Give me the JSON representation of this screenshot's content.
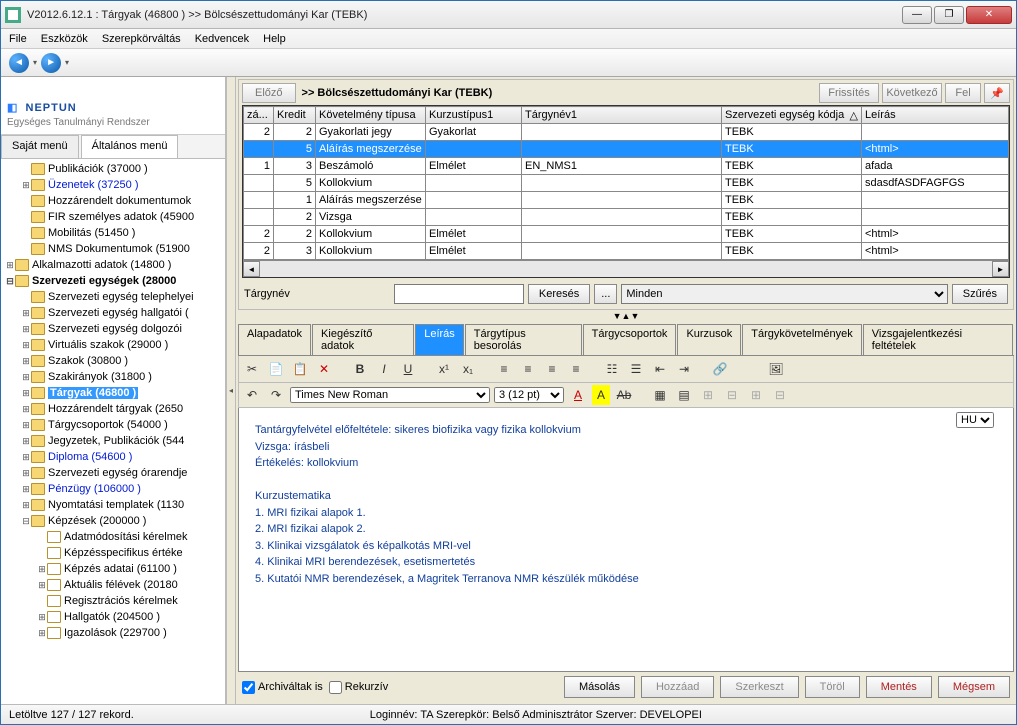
{
  "title": "V2012.6.12.1 : Tárgyak (46800  )  >> Bölcsészettudományi Kar (TEBK)",
  "menu": [
    "File",
    "Eszközök",
    "Szerepkörváltás",
    "Kedvencek",
    "Help"
  ],
  "logo": {
    "l1": "NEPTUN",
    "l2": "Egységes Tanulmányi Rendszer"
  },
  "left_tabs": {
    "t1": "Saját menü",
    "t2": "Általános menü"
  },
  "tree": [
    {
      "ind": 1,
      "tw": "",
      "ic": "f",
      "cls": "",
      "label": "Publikációk (37000  )"
    },
    {
      "ind": 1,
      "tw": "⊞",
      "ic": "f",
      "cls": "blue",
      "label": "Üzenetek (37250  )"
    },
    {
      "ind": 1,
      "tw": "",
      "ic": "f",
      "cls": "",
      "label": "Hozzárendelt dokumentumok"
    },
    {
      "ind": 1,
      "tw": "",
      "ic": "f",
      "cls": "",
      "label": "FIR személyes adatok (45900"
    },
    {
      "ind": 1,
      "tw": "",
      "ic": "f",
      "cls": "",
      "label": "Mobilitás (51450  )"
    },
    {
      "ind": 1,
      "tw": "",
      "ic": "f",
      "cls": "",
      "label": "NMS Dokumentumok (51900"
    },
    {
      "ind": 0,
      "tw": "⊞",
      "ic": "d",
      "cls": "",
      "label": "Alkalmazotti adatok (14800  )"
    },
    {
      "ind": 0,
      "tw": "⊟",
      "ic": "d",
      "cls": "bold",
      "label": "Szervezeti egységek (28000"
    },
    {
      "ind": 1,
      "tw": "",
      "ic": "f",
      "cls": "",
      "label": "Szervezeti egység telephelyei"
    },
    {
      "ind": 1,
      "tw": "⊞",
      "ic": "f",
      "cls": "",
      "label": "Szervezeti egység hallgatói ("
    },
    {
      "ind": 1,
      "tw": "⊞",
      "ic": "f",
      "cls": "",
      "label": "Szervezeti egység dolgozói"
    },
    {
      "ind": 1,
      "tw": "⊞",
      "ic": "f",
      "cls": "",
      "label": "Virtuális szakok (29000  )"
    },
    {
      "ind": 1,
      "tw": "⊞",
      "ic": "f",
      "cls": "",
      "label": "Szakok (30800  )"
    },
    {
      "ind": 1,
      "tw": "⊞",
      "ic": "f",
      "cls": "",
      "label": "Szakirányok (31800  )"
    },
    {
      "ind": 1,
      "tw": "⊞",
      "ic": "f",
      "cls": "sel",
      "label": "Tárgyak (46800  )"
    },
    {
      "ind": 1,
      "tw": "⊞",
      "ic": "f",
      "cls": "",
      "label": "Hozzárendelt tárgyak (2650"
    },
    {
      "ind": 1,
      "tw": "⊞",
      "ic": "f",
      "cls": "",
      "label": "Tárgycsoportok (54000  )"
    },
    {
      "ind": 1,
      "tw": "⊞",
      "ic": "f",
      "cls": "",
      "label": "Jegyzetek, Publikációk (544"
    },
    {
      "ind": 1,
      "tw": "⊞",
      "ic": "f",
      "cls": "blue",
      "label": "Diploma (54600  )"
    },
    {
      "ind": 1,
      "tw": "⊞",
      "ic": "f",
      "cls": "",
      "label": "Szervezeti egység órarendje"
    },
    {
      "ind": 1,
      "tw": "⊞",
      "ic": "f",
      "cls": "blue",
      "label": "Pénzügy (106000  )"
    },
    {
      "ind": 1,
      "tw": "⊞",
      "ic": "f",
      "cls": "",
      "label": "Nyomtatási templatek (1130"
    },
    {
      "ind": 1,
      "tw": "⊟",
      "ic": "f",
      "cls": "",
      "label": "Képzések (200000  )"
    },
    {
      "ind": 2,
      "tw": "",
      "ic": "p",
      "cls": "",
      "label": "Adatmódosítási kérelmek"
    },
    {
      "ind": 2,
      "tw": "",
      "ic": "p",
      "cls": "",
      "label": "Képzésspecifikus értéke"
    },
    {
      "ind": 2,
      "tw": "⊞",
      "ic": "p",
      "cls": "",
      "label": "Képzés adatai (61100  )"
    },
    {
      "ind": 2,
      "tw": "⊞",
      "ic": "p",
      "cls": "",
      "label": "Aktuális félévek (20180"
    },
    {
      "ind": 2,
      "tw": "",
      "ic": "p",
      "cls": "",
      "label": "Regisztrációs kérelmek"
    },
    {
      "ind": 2,
      "tw": "⊞",
      "ic": "p",
      "cls": "",
      "label": "Hallgatók (204500  )"
    },
    {
      "ind": 2,
      "tw": "⊞",
      "ic": "p",
      "cls": "",
      "label": "Igazolások (229700  )"
    }
  ],
  "bc": {
    "prev": "Előző",
    "path": ">>  Bölcsészettudományi Kar (TEBK)",
    "refresh": "Frissítés",
    "next": "Következő",
    "up": "Fel"
  },
  "grid": {
    "headers": {
      "c1": "zá...",
      "c2": "Kredit",
      "c3": "Követelmény típusa",
      "c4": "Kurzustípus1",
      "c5": "Tárgynév1",
      "c6": "Szervezeti egység kódja",
      "c7": "Leírás"
    },
    "rows": [
      {
        "c1": "2",
        "c2": "2",
        "c3": "Gyakorlati jegy",
        "c4": "Gyakorlat",
        "c5": "",
        "c6": "TEBK",
        "c7": "",
        "sel": false
      },
      {
        "c1": "",
        "c2": "5",
        "c3": "Aláírás megszerzése",
        "c4": "",
        "c5": "",
        "c6": "TEBK",
        "c7": "<html>",
        "sel": true
      },
      {
        "c1": "1",
        "c2": "3",
        "c3": "Beszámoló",
        "c4": "Elmélet",
        "c5": "EN_NMS1",
        "c6": "TEBK",
        "c7": "afada",
        "sel": false
      },
      {
        "c1": "",
        "c2": "5",
        "c3": "Kollokvium",
        "c4": "",
        "c5": "",
        "c6": "TEBK",
        "c7": "sdasdfASDFAGFGS",
        "sel": false
      },
      {
        "c1": "",
        "c2": "1",
        "c3": "Aláírás megszerzése",
        "c4": "",
        "c5": "",
        "c6": "TEBK",
        "c7": "",
        "sel": false
      },
      {
        "c1": "",
        "c2": "2",
        "c3": "Vizsga",
        "c4": "",
        "c5": "",
        "c6": "TEBK",
        "c7": "",
        "sel": false
      },
      {
        "c1": "2",
        "c2": "2",
        "c3": "Kollokvium",
        "c4": "Elmélet",
        "c5": "",
        "c6": "TEBK",
        "c7": "<html>",
        "sel": false
      },
      {
        "c1": "2",
        "c2": "3",
        "c3": "Kollokvium",
        "c4": "Elmélet",
        "c5": "",
        "c6": "TEBK",
        "c7": "<html>",
        "sel": false
      }
    ]
  },
  "search": {
    "label": "Tárgynév",
    "btn": "Keresés",
    "dots": "...",
    "all": "Minden",
    "filter": "Szűrés"
  },
  "tabs": [
    "Alapadatok",
    "Kiegészítő adatok",
    "Leírás",
    "Tárgytípus besorolás",
    "Tárgycsoportok",
    "Kurzusok",
    "Tárgykövetelmények",
    "Vizsgajelentkezési feltételek"
  ],
  "active_tab": 2,
  "font": {
    "name": "Times New Roman",
    "size": "3 (12 pt)",
    "lang": "HU"
  },
  "editor_lines": [
    "Tantárgyfelvétel előfeltétele: sikeres biofizika  vagy fizika  kollokvium",
    "Vizsga: írásbeli",
    "Értékelés: kollokvium",
    "",
    "Kurzustematika",
    "1.     MRI fizikai alapok 1.",
    "2.     MRI fizikai alapok 2.",
    "3.     Klinikai vizsgálatok és képalkotás MRI-vel",
    "4.     Klinikai MRI berendezések, esetismertetés",
    "5.     Kutatói NMR berendezések, a Magritek Terranova NMR készülék működése"
  ],
  "bottom": {
    "arch": "Archiváltak is",
    "rec": "Rekurzív",
    "copy": "Másolás",
    "add": "Hozzáad",
    "edit": "Szerkeszt",
    "del": "Töröl",
    "save": "Mentés",
    "cancel": "Mégsem"
  },
  "status": {
    "s1": "Letöltve 127 / 127 rekord.",
    "s2": "Loginnév: TA   Szerepkör: Belső Adminisztrátor   Szerver: DEVELOPEI"
  }
}
